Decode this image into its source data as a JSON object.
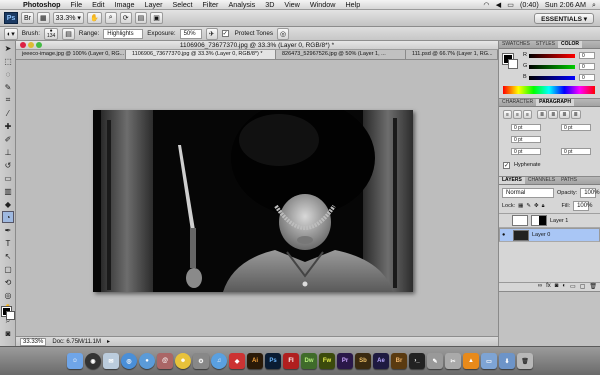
{
  "menubar": {
    "app": "Photoshop",
    "items": [
      "File",
      "Edit",
      "Image",
      "Layer",
      "Select",
      "Filter",
      "Analysis",
      "3D",
      "View",
      "Window",
      "Help"
    ],
    "battery": "(0:40)",
    "clock": "Sun 2:06 AM"
  },
  "appbar": {
    "ps": "Ps",
    "zoom": "33.3%",
    "workspace": "ESSENTIALS ▾"
  },
  "options": {
    "brush_label": "Brush:",
    "brush_size": "134",
    "range_label": "Range:",
    "range_value": "Highlights",
    "exposure_label": "Exposure:",
    "exposure_value": "50%",
    "protect_label": "Protect Tones"
  },
  "document": {
    "title": "1106906_73677370.jpg @ 33.3% (Layer 0, RGB/8*) *",
    "tabs": [
      "jeeeco-image.jpg @ 100% (Layer 0, RG...",
      "1106906_73677370.jpg @ 33.3% (Layer 0, RGB/8*) *",
      "826473_52967526.jpg @ 50% (Layer 1, ...",
      "111.psd @ 66.7% (Layer 1, RG..."
    ]
  },
  "status": {
    "zoom": "33.33%",
    "doc": "Doc: 6.75M/11.1M"
  },
  "panels": {
    "color_tabs": [
      "SWATCHES",
      "STYLES",
      "COLOR"
    ],
    "color_rows": [
      {
        "label": "R",
        "value": "0"
      },
      {
        "label": "G",
        "value": "0"
      },
      {
        "label": "B",
        "value": "0"
      }
    ],
    "para_tabs": [
      "CHARACTER",
      "PARAGRAPH"
    ],
    "para_fields": [
      "0 pt",
      "0 pt",
      "0 pt",
      "0 pt",
      "0 pt"
    ],
    "hyphenate": "Hyphenate",
    "layer_tabs": [
      "LAYERS",
      "CHANNELS",
      "PATHS"
    ],
    "blend": "Normal",
    "opacity_label": "Opacity:",
    "opacity": "100%",
    "lock_label": "Lock:",
    "fill_label": "Fill:",
    "fill": "100%",
    "layers": [
      "Layer 1",
      "Layer 0"
    ]
  },
  "dock": {
    "items": [
      "Ai",
      "Ps",
      "Fl",
      "Dw",
      "Fw",
      "Pr",
      "Sb",
      "Ae",
      "Br"
    ]
  },
  "colors": {
    "ps_blue": "#1b3a63",
    "selection": "#a9c6f5"
  }
}
